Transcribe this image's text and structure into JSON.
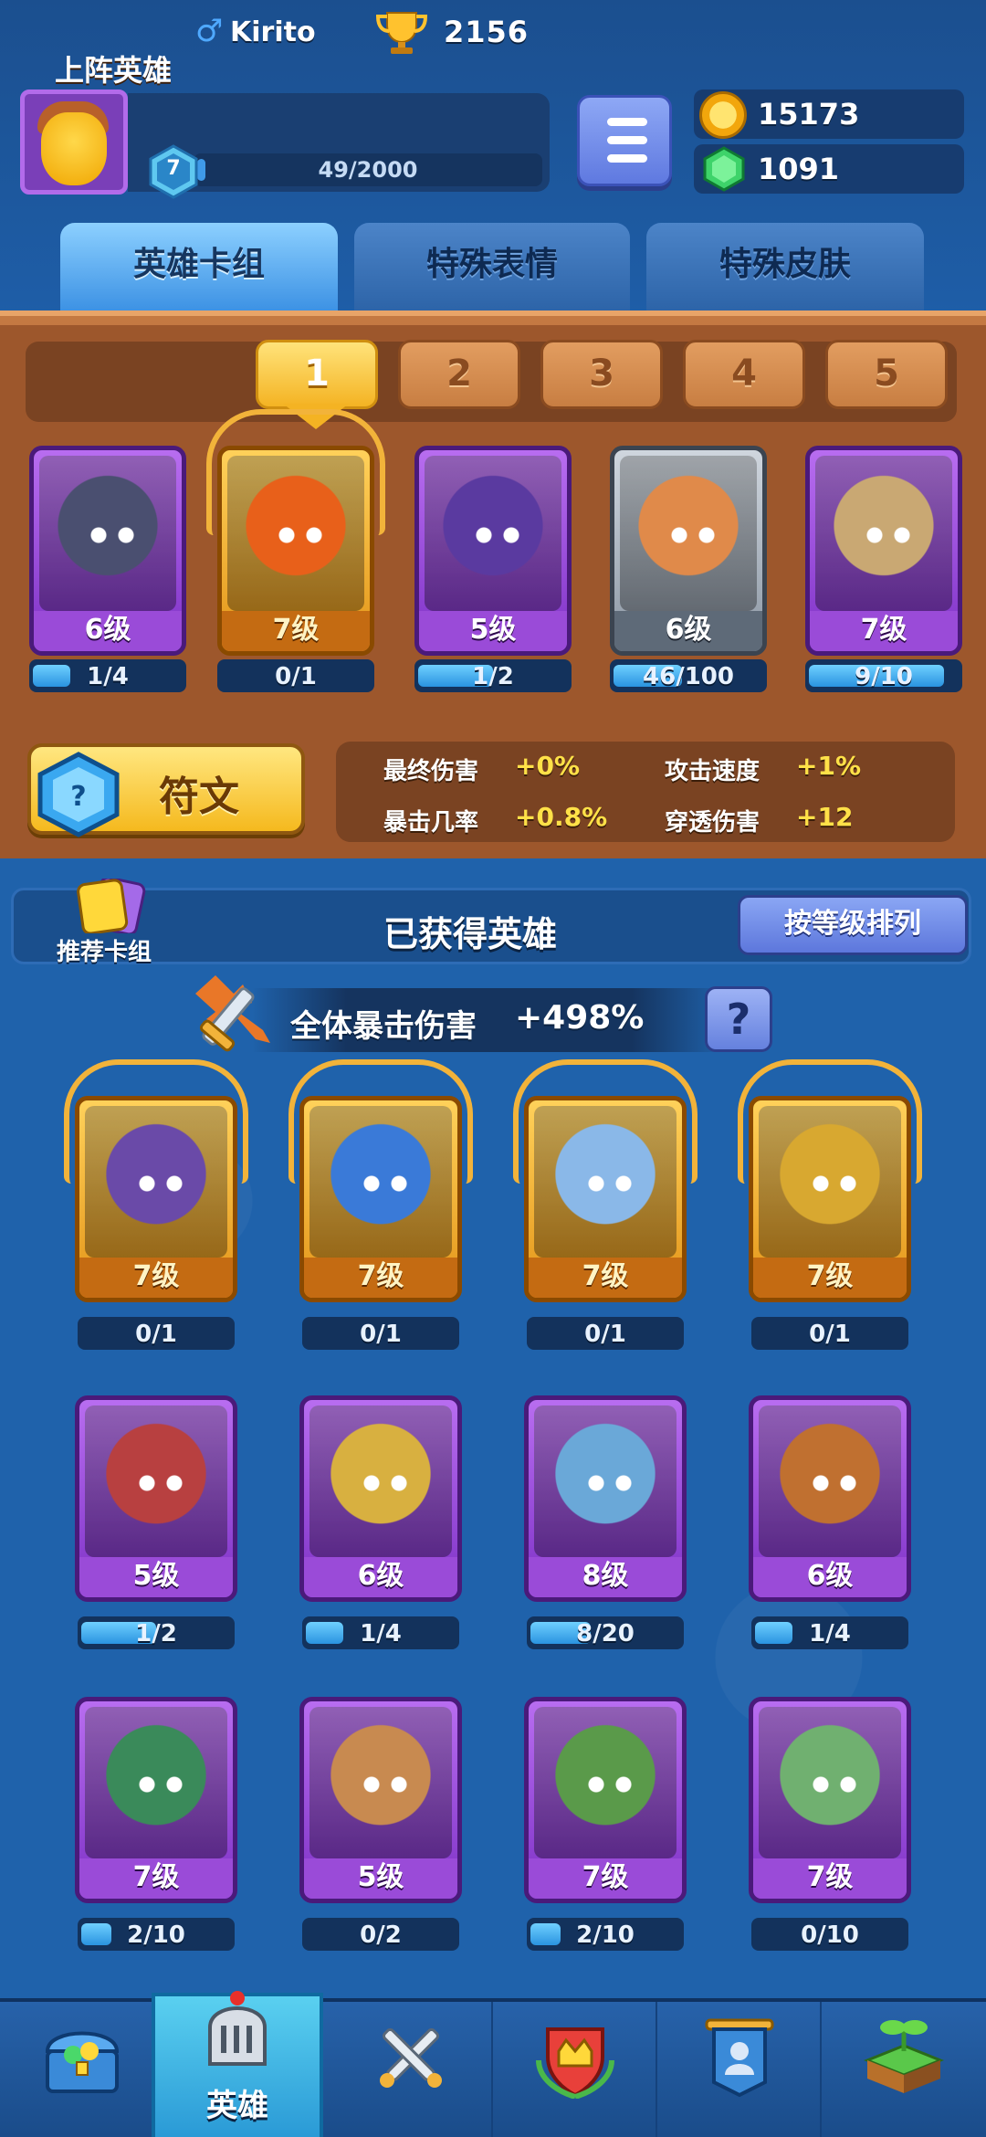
{
  "player": {
    "name": "Kirito",
    "trophies": "2156",
    "level": "7",
    "xp": "49/2000",
    "xp_fraction": 0.0245
  },
  "currency": {
    "gold": "15173",
    "gems": "1091"
  },
  "tabs": [
    {
      "label": "英雄卡组",
      "active": true
    },
    {
      "label": "特殊表情",
      "active": false
    },
    {
      "label": "特殊皮肤",
      "active": false
    }
  ],
  "lineup": {
    "label": "上阵英雄",
    "slots": [
      "1",
      "2",
      "3",
      "4",
      "5"
    ],
    "active_slot": "1",
    "heroes": [
      {
        "level": "6级",
        "progress": "1/4",
        "fraction": 0.25,
        "rarity": "purple",
        "color": "#4a4f70"
      },
      {
        "level": "7级",
        "progress": "0/1",
        "fraction": 0,
        "rarity": "gold",
        "color": "#e8601a"
      },
      {
        "level": "5级",
        "progress": "1/2",
        "fraction": 0.5,
        "rarity": "purple",
        "color": "#5a3aa0"
      },
      {
        "level": "6级",
        "progress": "46/100",
        "fraction": 0.46,
        "rarity": "gray",
        "color": "#e08a4a"
      },
      {
        "level": "7级",
        "progress": "9/10",
        "fraction": 0.9,
        "rarity": "purple",
        "color": "#c9a873"
      }
    ]
  },
  "rune": {
    "label": "符文",
    "stats": [
      {
        "name": "最终伤害",
        "value": "+0%"
      },
      {
        "name": "攻击速度",
        "value": "+1%"
      },
      {
        "name": "暴击几率",
        "value": "+0.8%"
      },
      {
        "name": "穿透伤害",
        "value": "+12"
      }
    ]
  },
  "obtained": {
    "recommend_label": "推荐卡组",
    "title": "已获得英雄",
    "sort_label": "按等级排列",
    "crit_label": "全体暴击伤害",
    "crit_value": "+498%",
    "help_label": "?",
    "heroes": [
      {
        "level": "7级",
        "progress": "0/1",
        "fraction": 0,
        "rarity": "gold",
        "color": "#6a4aa8"
      },
      {
        "level": "7级",
        "progress": "0/1",
        "fraction": 0,
        "rarity": "gold",
        "color": "#3a7ad8"
      },
      {
        "level": "7级",
        "progress": "0/1",
        "fraction": 0,
        "rarity": "gold",
        "color": "#8ab8e8"
      },
      {
        "level": "7级",
        "progress": "0/1",
        "fraction": 0,
        "rarity": "gold",
        "color": "#d8a830"
      },
      {
        "level": "5级",
        "progress": "1/2",
        "fraction": 0.5,
        "rarity": "purple",
        "color": "#b84040"
      },
      {
        "level": "6级",
        "progress": "1/4",
        "fraction": 0.25,
        "rarity": "purple",
        "color": "#d8b040"
      },
      {
        "level": "8级",
        "progress": "8/20",
        "fraction": 0.4,
        "rarity": "purple",
        "color": "#6aa8d8"
      },
      {
        "level": "6级",
        "progress": "1/4",
        "fraction": 0.25,
        "rarity": "purple",
        "color": "#c07030"
      },
      {
        "level": "7级",
        "progress": "2/10",
        "fraction": 0.2,
        "rarity": "purple",
        "color": "#3a8a5a"
      },
      {
        "level": "5级",
        "progress": "0/2",
        "fraction": 0,
        "rarity": "purple",
        "color": "#c88a50"
      },
      {
        "level": "7级",
        "progress": "2/10",
        "fraction": 0.2,
        "rarity": "purple",
        "color": "#5a9a4a"
      },
      {
        "level": "7级",
        "progress": "0/10",
        "fraction": 0,
        "rarity": "purple",
        "color": "#70b070"
      }
    ]
  },
  "nav": [
    {
      "label": "",
      "icon": "treasure-chest-icon",
      "active": false
    },
    {
      "label": "英雄",
      "icon": "knight-helmet-icon",
      "active": true
    },
    {
      "label": "",
      "icon": "crossed-swords-icon",
      "active": false
    },
    {
      "label": "",
      "icon": "crown-shield-icon",
      "active": false
    },
    {
      "label": "",
      "icon": "guild-banner-icon",
      "active": false
    },
    {
      "label": "",
      "icon": "sprout-island-icon",
      "active": false
    }
  ]
}
